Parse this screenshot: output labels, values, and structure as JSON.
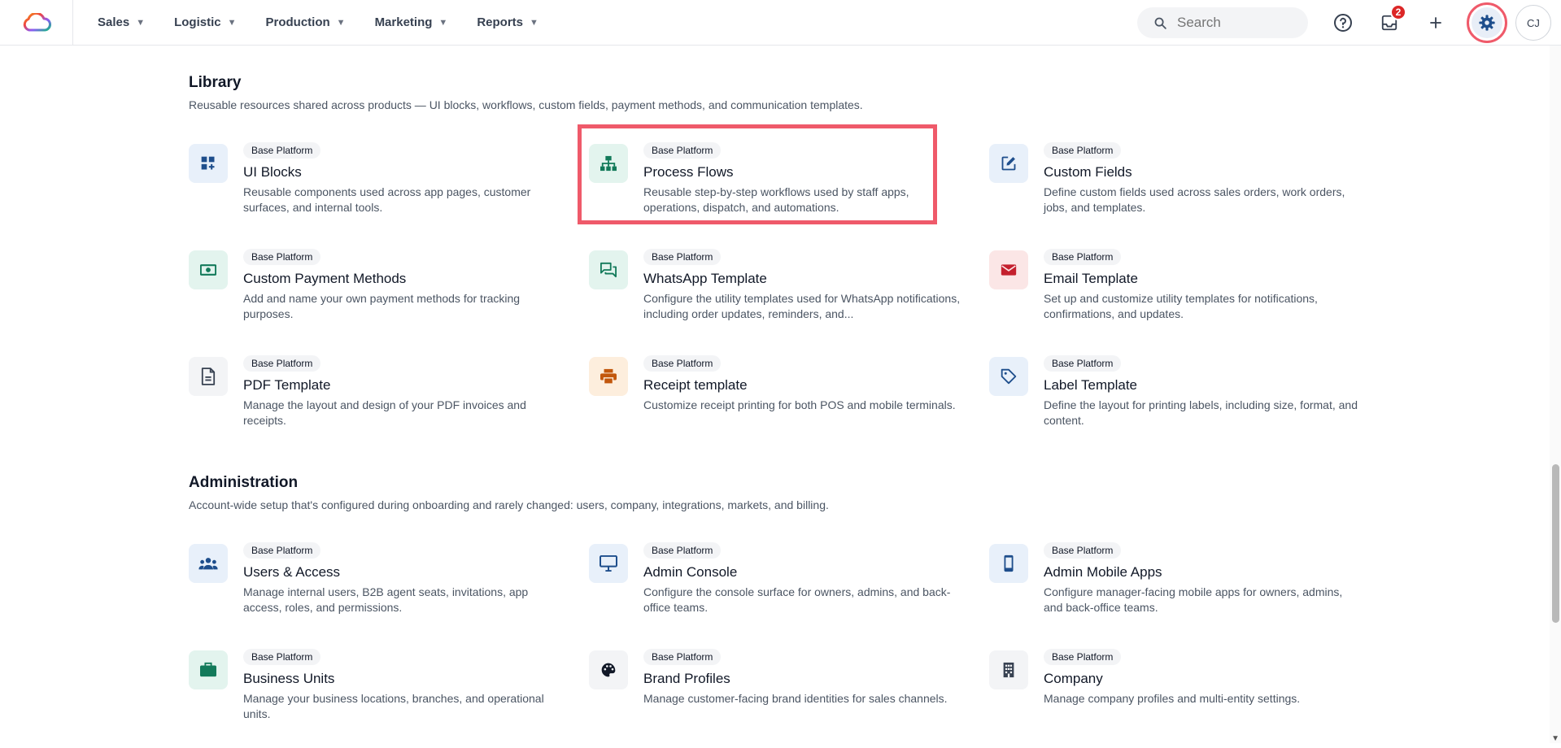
{
  "nav": {
    "items": [
      {
        "label": "Sales"
      },
      {
        "label": "Logistic"
      },
      {
        "label": "Production"
      },
      {
        "label": "Marketing"
      },
      {
        "label": "Reports"
      }
    ],
    "search_placeholder": "Search",
    "notification_count": "2",
    "avatar_initials": "CJ",
    "icons": {
      "logo": "cloud-logo",
      "help": "help-circle-icon",
      "inbox": "inbox-icon",
      "add": "plus-icon",
      "settings": "gear-icon",
      "search": "search-icon"
    }
  },
  "library": {
    "title": "Library",
    "description": "Reusable resources shared across products — UI blocks, workflows, custom fields, payment methods, and communication templates.",
    "cards": [
      {
        "tag": "Base Platform",
        "title": "UI Blocks",
        "desc": "Reusable components used across app pages, customer surfaces, and internal tools.",
        "icon": "dashboard-add-icon",
        "color": "#1e4e8c",
        "bg": "#e8f0fa"
      },
      {
        "tag": "Base Platform",
        "title": "Process Flows",
        "desc": "Reusable step-by-step workflows used by staff apps, operations, dispatch, and automations.",
        "icon": "sitemap-icon",
        "color": "#137a5a",
        "bg": "#e3f4ee"
      },
      {
        "tag": "Base Platform",
        "title": "Custom Fields",
        "desc": "Define custom fields used across sales orders, work orders, jobs, and templates.",
        "icon": "edit-square-icon",
        "color": "#1e4e8c",
        "bg": "#e8f0fa"
      },
      {
        "tag": "Base Platform",
        "title": "Custom Payment Methods",
        "desc": "Add and name your own payment methods for tracking purposes.",
        "icon": "cash-icon",
        "color": "#137a5a",
        "bg": "#e3f4ee"
      },
      {
        "tag": "Base Platform",
        "title": "WhatsApp Template",
        "desc": "Configure the utility templates used for WhatsApp notifications, including order updates, reminders, and...",
        "icon": "chat-bubbles-icon",
        "color": "#137a5a",
        "bg": "#e3f4ee"
      },
      {
        "tag": "Base Platform",
        "title": "Email Template",
        "desc": "Set up and customize utility templates for notifications, confirmations, and updates.",
        "icon": "envelope-icon",
        "color": "#c4202e",
        "bg": "#fbe6e6"
      },
      {
        "tag": "Base Platform",
        "title": "PDF Template",
        "desc": "Manage the layout and design of your PDF invoices and receipts.",
        "icon": "document-icon",
        "color": "#374151",
        "bg": "#f3f4f6"
      },
      {
        "tag": "Base Platform",
        "title": "Receipt template",
        "desc": "Customize receipt printing for both POS and mobile terminals.",
        "icon": "printer-icon",
        "color": "#c2570c",
        "bg": "#fdeedd"
      },
      {
        "tag": "Base Platform",
        "title": "Label Template",
        "desc": "Define the layout for printing labels, including size, format, and content.",
        "icon": "tag-icon",
        "color": "#1e4e8c",
        "bg": "#e8f0fa"
      }
    ]
  },
  "administration": {
    "title": "Administration",
    "description": "Account-wide setup that's configured during onboarding and rarely changed: users, company, integrations, markets, and billing.",
    "cards": [
      {
        "tag": "Base Platform",
        "title": "Users & Access",
        "desc": "Manage internal users, B2B agent seats, invitations, app access, roles, and permissions.",
        "icon": "users-icon",
        "color": "#1e4e8c",
        "bg": "#e8f0fa"
      },
      {
        "tag": "Base Platform",
        "title": "Admin Console",
        "desc": "Configure the console surface for owners, admins, and back-office teams.",
        "icon": "monitor-icon",
        "color": "#1e4e8c",
        "bg": "#e8f0fa"
      },
      {
        "tag": "Base Platform",
        "title": "Admin Mobile Apps",
        "desc": "Configure manager-facing mobile apps for owners, admins, and back-office teams.",
        "icon": "mobile-icon",
        "color": "#1e4e8c",
        "bg": "#e8f0fa"
      },
      {
        "tag": "Base Platform",
        "title": "Business Units",
        "desc": "Manage your business locations, branches, and operational units.",
        "icon": "briefcase-icon",
        "color": "#137a5a",
        "bg": "#e3f4ee"
      },
      {
        "tag": "Base Platform",
        "title": "Brand Profiles",
        "desc": "Manage customer-facing brand identities for sales channels.",
        "icon": "palette-icon",
        "color": "#111827",
        "bg": "#f3f4f6"
      },
      {
        "tag": "Base Platform",
        "title": "Company",
        "desc": "Manage company profiles and multi-entity settings.",
        "icon": "building-icon",
        "color": "#374151",
        "bg": "#f3f4f6"
      }
    ]
  }
}
